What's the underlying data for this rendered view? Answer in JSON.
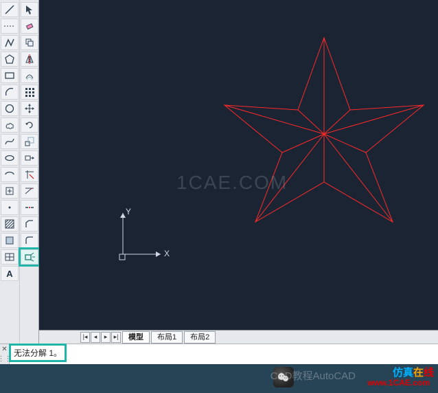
{
  "canvas": {
    "watermark": "1CAE.COM",
    "ucs": {
      "x_label": "X",
      "y_label": "Y"
    }
  },
  "tabs": {
    "active": "模型",
    "items": [
      "模型",
      "布局1",
      "布局2"
    ]
  },
  "command_line": {
    "text": "无法分解 1。"
  },
  "toolbars": {
    "highlighted_index": [
      1,
      15
    ],
    "left_icons": [
      "line-icon",
      "construction-line-icon",
      "polyline-icon",
      "polygon-icon",
      "rectangle-icon",
      "arc-icon",
      "circle-icon",
      "revision-cloud-icon",
      "spline-icon",
      "ellipse-icon",
      "ellipse-arc-icon",
      "block-insert-icon",
      "make-block-icon",
      "point-icon",
      "hatch-icon",
      "gradient-icon",
      "region-icon",
      "table-icon",
      "text-icon"
    ],
    "right_icons": [
      "cursor-icon",
      "erase-icon",
      "copy-icon",
      "mirror-icon",
      "offset-icon",
      "array-icon",
      "move-icon",
      "rotate-icon",
      "scale-icon",
      "stretch-icon",
      "trim-icon",
      "extend-icon",
      "break-at-point-icon",
      "chamfer-icon",
      "fillet-icon",
      "explode-icon"
    ]
  },
  "footer": {
    "footer_text": "CAD教程AutoCAD",
    "brand_a": "仿真",
    "brand_b": "在",
    "brand_c": "线",
    "url": "www.1CAE.com"
  }
}
